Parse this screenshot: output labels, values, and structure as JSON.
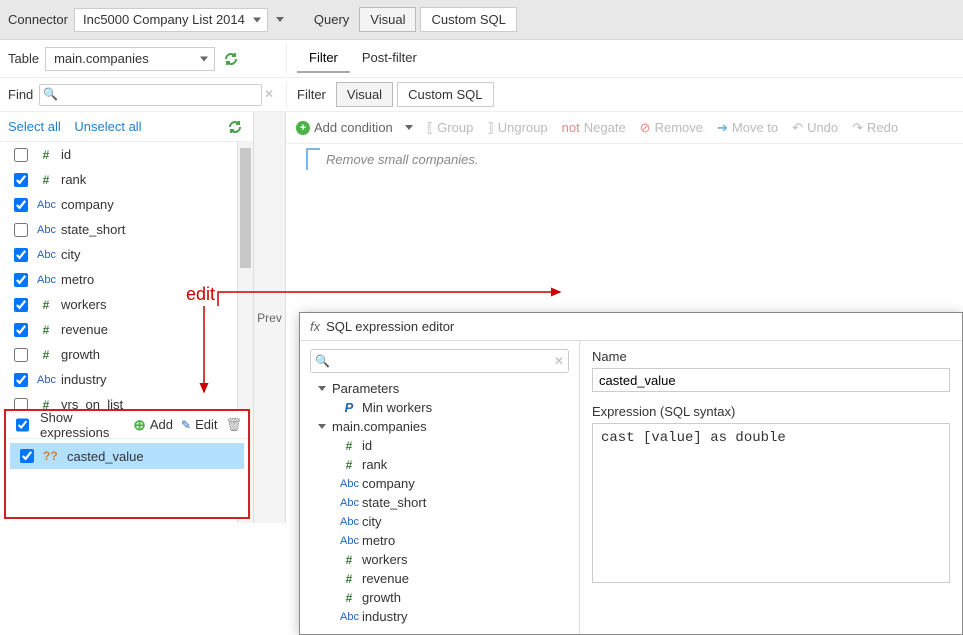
{
  "topbar": {
    "connector_label": "Connector",
    "connector_value": "Inc5000 Company List 2014",
    "query_label": "Query",
    "visual": "Visual",
    "custom_sql": "Custom SQL"
  },
  "row2": {
    "table_label": "Table",
    "table_value": "main.companies",
    "filter_tab": "Filter",
    "postfilter_tab": "Post-filter"
  },
  "row3": {
    "find_label": "Find",
    "filter_label": "Filter",
    "visual": "Visual",
    "custom_sql": "Custom SQL"
  },
  "selbar": {
    "select_all": "Select all",
    "unselect_all": "Unselect all"
  },
  "fields": [
    {
      "checked": false,
      "type": "num",
      "name": "id"
    },
    {
      "checked": true,
      "type": "num",
      "name": "rank"
    },
    {
      "checked": true,
      "type": "abc",
      "name": "company"
    },
    {
      "checked": false,
      "type": "abc",
      "name": "state_short"
    },
    {
      "checked": true,
      "type": "abc",
      "name": "city"
    },
    {
      "checked": true,
      "type": "abc",
      "name": "metro"
    },
    {
      "checked": true,
      "type": "num",
      "name": "workers"
    },
    {
      "checked": true,
      "type": "num",
      "name": "revenue"
    },
    {
      "checked": false,
      "type": "num",
      "name": "growth"
    },
    {
      "checked": true,
      "type": "abc",
      "name": "industry"
    },
    {
      "checked": false,
      "type": "num",
      "name": "yrs_on_list"
    }
  ],
  "preview_label": "Prev",
  "toolbar": {
    "add_condition": "Add condition",
    "group": "Group",
    "ungroup": "Ungroup",
    "negate": "Negate",
    "remove": "Remove",
    "move_to": "Move to",
    "undo": "Undo",
    "redo": "Redo"
  },
  "condition_comment": "Remove small companies.",
  "expressions": {
    "show_label": "Show expressions",
    "add": "Add",
    "edit": "Edit",
    "item_name": "casted_value"
  },
  "annotation": {
    "edit_label": "edit"
  },
  "editor": {
    "title": "SQL expression editor",
    "name_label": "Name",
    "name_value": "casted_value",
    "expr_label": "Expression (SQL syntax)",
    "expr_value": "cast [value] as double",
    "tree_parameters": "Parameters",
    "tree_min_workers": "Min workers",
    "tree_main": "main.companies",
    "tree_fields": [
      "id",
      "rank",
      "company",
      "state_short",
      "city",
      "metro",
      "workers",
      "revenue",
      "growth",
      "industry"
    ],
    "tree_types": [
      "num",
      "num",
      "abc",
      "abc",
      "abc",
      "abc",
      "num",
      "num",
      "num",
      "abc"
    ]
  }
}
